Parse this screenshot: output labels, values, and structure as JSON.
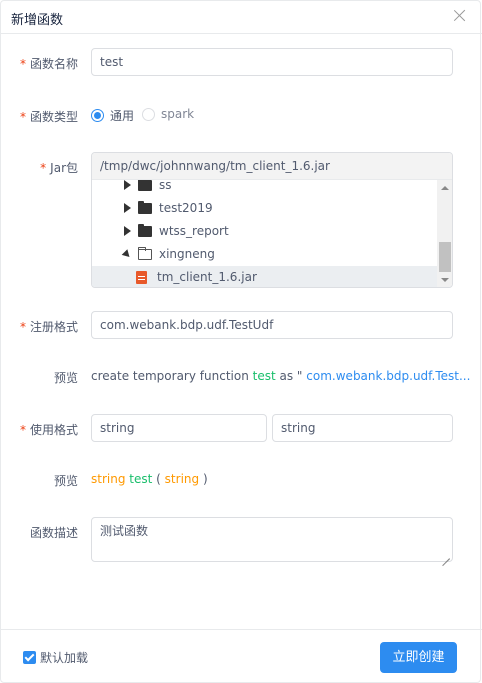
{
  "dialog": {
    "title": "新增函数"
  },
  "form": {
    "name": {
      "label": "函数名称",
      "required": "*",
      "value": "test"
    },
    "type": {
      "label": "函数类型",
      "required": "*",
      "options": [
        "通用",
        "spark"
      ],
      "selected": "通用"
    },
    "jar": {
      "label": "Jar包",
      "required": "*",
      "path": "/tmp/dwc/johnnwang/tm_client_1.6.jar",
      "tree": [
        {
          "name": "ss",
          "kind": "folder",
          "expanded": false
        },
        {
          "name": "test2019",
          "kind": "folder",
          "expanded": false
        },
        {
          "name": "wtss_report",
          "kind": "folder",
          "expanded": false
        },
        {
          "name": "xingneng",
          "kind": "folder",
          "expanded": true
        },
        {
          "name": "tm_client_1.6.jar",
          "kind": "jar",
          "selected": true
        }
      ]
    },
    "register": {
      "label": "注册格式",
      "required": "*",
      "value": "com.webank.bdp.udf.TestUdf"
    },
    "register_preview": {
      "label": "预览",
      "prefix": "create temporary function",
      "fn_name": "test",
      "as": "as \"",
      "class_truncated": "com.webank.bdp.udf.Test..."
    },
    "usage": {
      "label": "使用格式",
      "required": "*",
      "return_type": "string",
      "param_type": "string"
    },
    "usage_preview": {
      "label": "预览",
      "return_type": "string",
      "fn_name": "test",
      "open_paren": "(",
      "param_type": "string",
      "close_paren": ")"
    },
    "description": {
      "label": "函数描述",
      "value": "测试函数"
    }
  },
  "footer": {
    "default_load_label": "默认加载",
    "default_load_checked": true,
    "create_button": "立即创建"
  },
  "colors": {
    "primary": "#2d8cf0",
    "required": "#ed4014",
    "green": "#19be6b",
    "orange": "#ff9900"
  }
}
